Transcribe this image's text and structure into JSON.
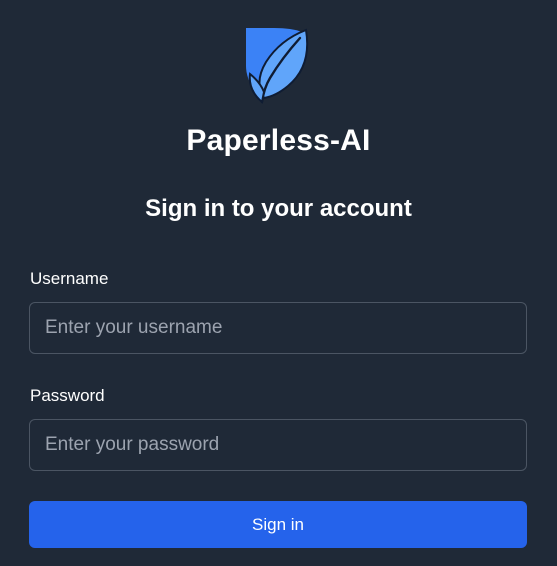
{
  "app": {
    "title": "Paperless-AI",
    "logo_icon": "leaf-document-icon",
    "colors": {
      "background": "#1f2937",
      "accent": "#2563eb",
      "logo_blue": "#3b82f6",
      "logo_light": "#60a5fa"
    }
  },
  "login": {
    "heading": "Sign in to your account",
    "username": {
      "label": "Username",
      "placeholder": "Enter your username",
      "value": ""
    },
    "password": {
      "label": "Password",
      "placeholder": "Enter your password",
      "value": ""
    },
    "submit_label": "Sign in"
  }
}
